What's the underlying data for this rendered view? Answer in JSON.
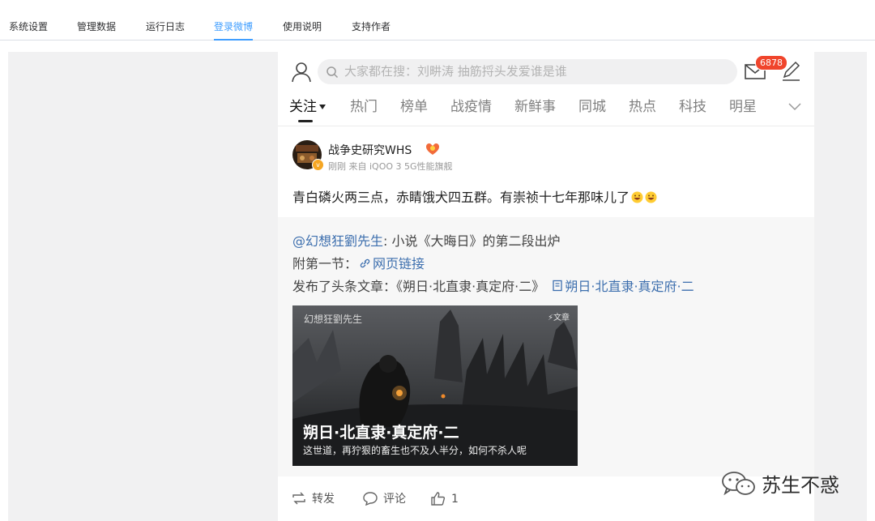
{
  "tabs": [
    {
      "label": "系统设置",
      "active": false
    },
    {
      "label": "管理数据",
      "active": false
    },
    {
      "label": "运行日志",
      "active": false
    },
    {
      "label": "登录微博",
      "active": true
    },
    {
      "label": "使用说明",
      "active": false
    },
    {
      "label": "支持作者",
      "active": false
    }
  ],
  "colors": {
    "accent": "#409eff",
    "badge": "#f0452c",
    "link": "#3d6fae"
  },
  "weibo": {
    "search_placeholder": "大家都在搜：刘畊涛 抽筋捋头发爱谁是谁",
    "mail_badge": "6878",
    "nav": [
      "关注",
      "热门",
      "榜单",
      "战疫情",
      "新鲜事",
      "同城",
      "热点",
      "科技",
      "明星"
    ],
    "post": {
      "author": "战争史研究WHS",
      "meta": "刚刚 来自 iQOO 3 5G性能旗舰",
      "text": "青白磷火两三点，赤睛饿犬四五群。有崇祯十七年那味儿了",
      "repost": {
        "mention": "@幻想狂劉先生",
        "line1_rest": ": 小说《大晦日》的第二段出炉",
        "line2_prefix": "附第一节：",
        "line2_link": "网页链接",
        "line3_prefix": "发布了头条文章：《朔日·北直隶·真定府·二》",
        "line3_link": "朔日·北直隶·真定府·二",
        "card": {
          "author": "幻想狂劉先生",
          "tag": "⚡文章",
          "title": "朔日·北直隶·真定府·二",
          "subtitle": "这世道，再狞狠的畜生也不及人半分，如何不杀人呢"
        }
      },
      "actions": {
        "repost": "转发",
        "comment": "评论",
        "like": "1"
      }
    }
  },
  "watermark": "苏生不惑",
  "icons": [
    "profile-icon",
    "search-icon",
    "mail-icon",
    "compose-icon",
    "chevron-down-icon",
    "vip-icon",
    "link-icon",
    "article-icon",
    "repost-icon",
    "comment-icon",
    "like-icon",
    "wechat-icon"
  ]
}
